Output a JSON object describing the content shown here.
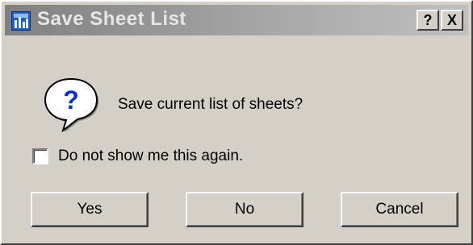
{
  "window": {
    "title": "Save Sheet List",
    "help_label": "?",
    "close_label": "X",
    "app_icon": "sheet-list-icon"
  },
  "message": {
    "icon": "question-icon",
    "text": "Save current list of sheets?"
  },
  "checkbox": {
    "label": "Do not show me this again.",
    "checked": false
  },
  "buttons": {
    "yes": "Yes",
    "no": "No",
    "cancel": "Cancel"
  }
}
